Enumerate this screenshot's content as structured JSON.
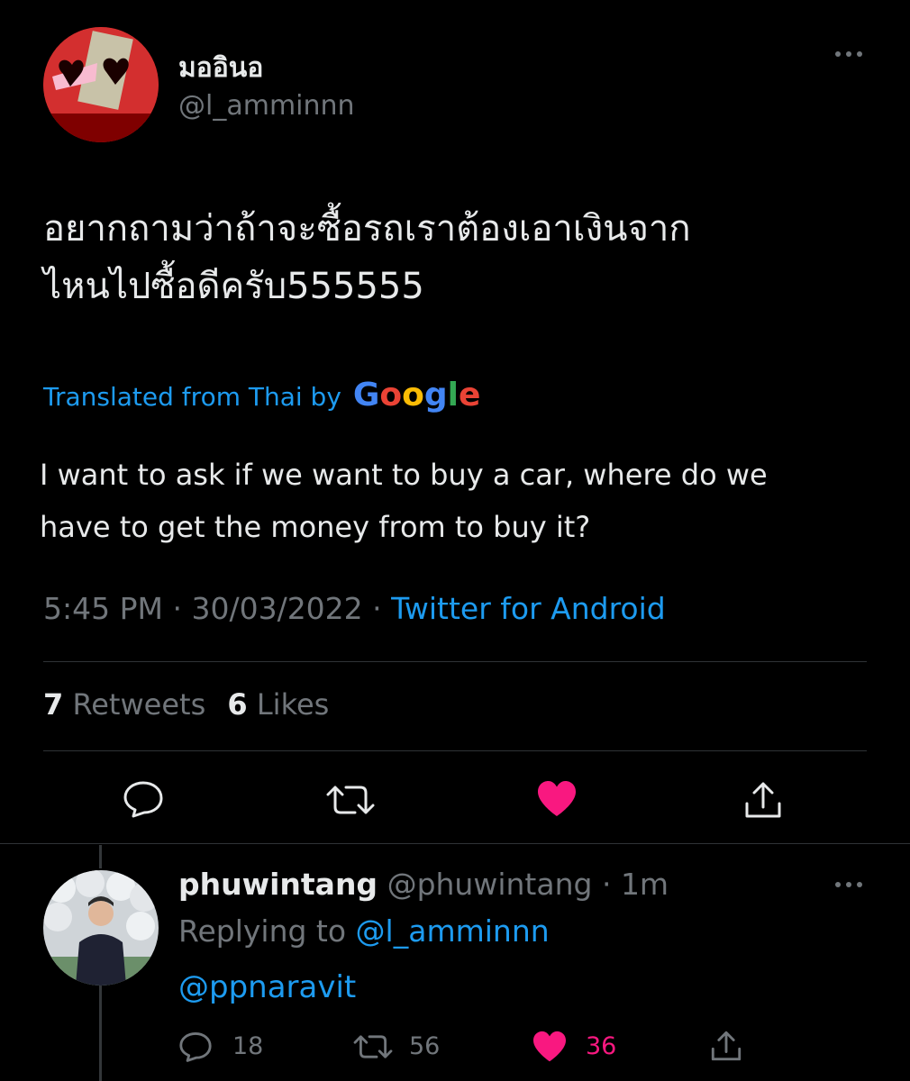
{
  "tweet": {
    "display_name": "มออินอ",
    "handle": "@l_amminnn",
    "text_lines": [
      "อยากถามว่าถ้าจะซื้อรถเราต้องเอาเงินจาก",
      "ไหนไปซื้อดีครับ555555"
    ],
    "translation_label": "Translated from Thai by",
    "translation_provider": "Google",
    "translation_lines": [
      "I want to ask if we want to buy a car, where do we",
      "have to get the money from to buy it?"
    ],
    "time": "5:45 PM",
    "date": "30/03/2022",
    "separator": "·",
    "source": "Twitter for Android",
    "retweet_count": "7",
    "retweet_label": "Retweets",
    "like_count": "6",
    "like_label": "Likes",
    "liked": true
  },
  "reply": {
    "display_name": "phuwintang",
    "handle": "@phuwintang",
    "separator": "·",
    "age": "1m",
    "replying_prefix": "Replying to",
    "replying_to": "@l_amminnn",
    "text": "@ppnaravit",
    "replies": "18",
    "retweets": "56",
    "likes": "36",
    "liked": true
  },
  "more_icon": "more-horizontal-icon",
  "colors": {
    "background": "#000000",
    "accent": "#1d9bf0",
    "like": "#f91880",
    "muted": "#71767b",
    "divider": "#2f3336"
  }
}
